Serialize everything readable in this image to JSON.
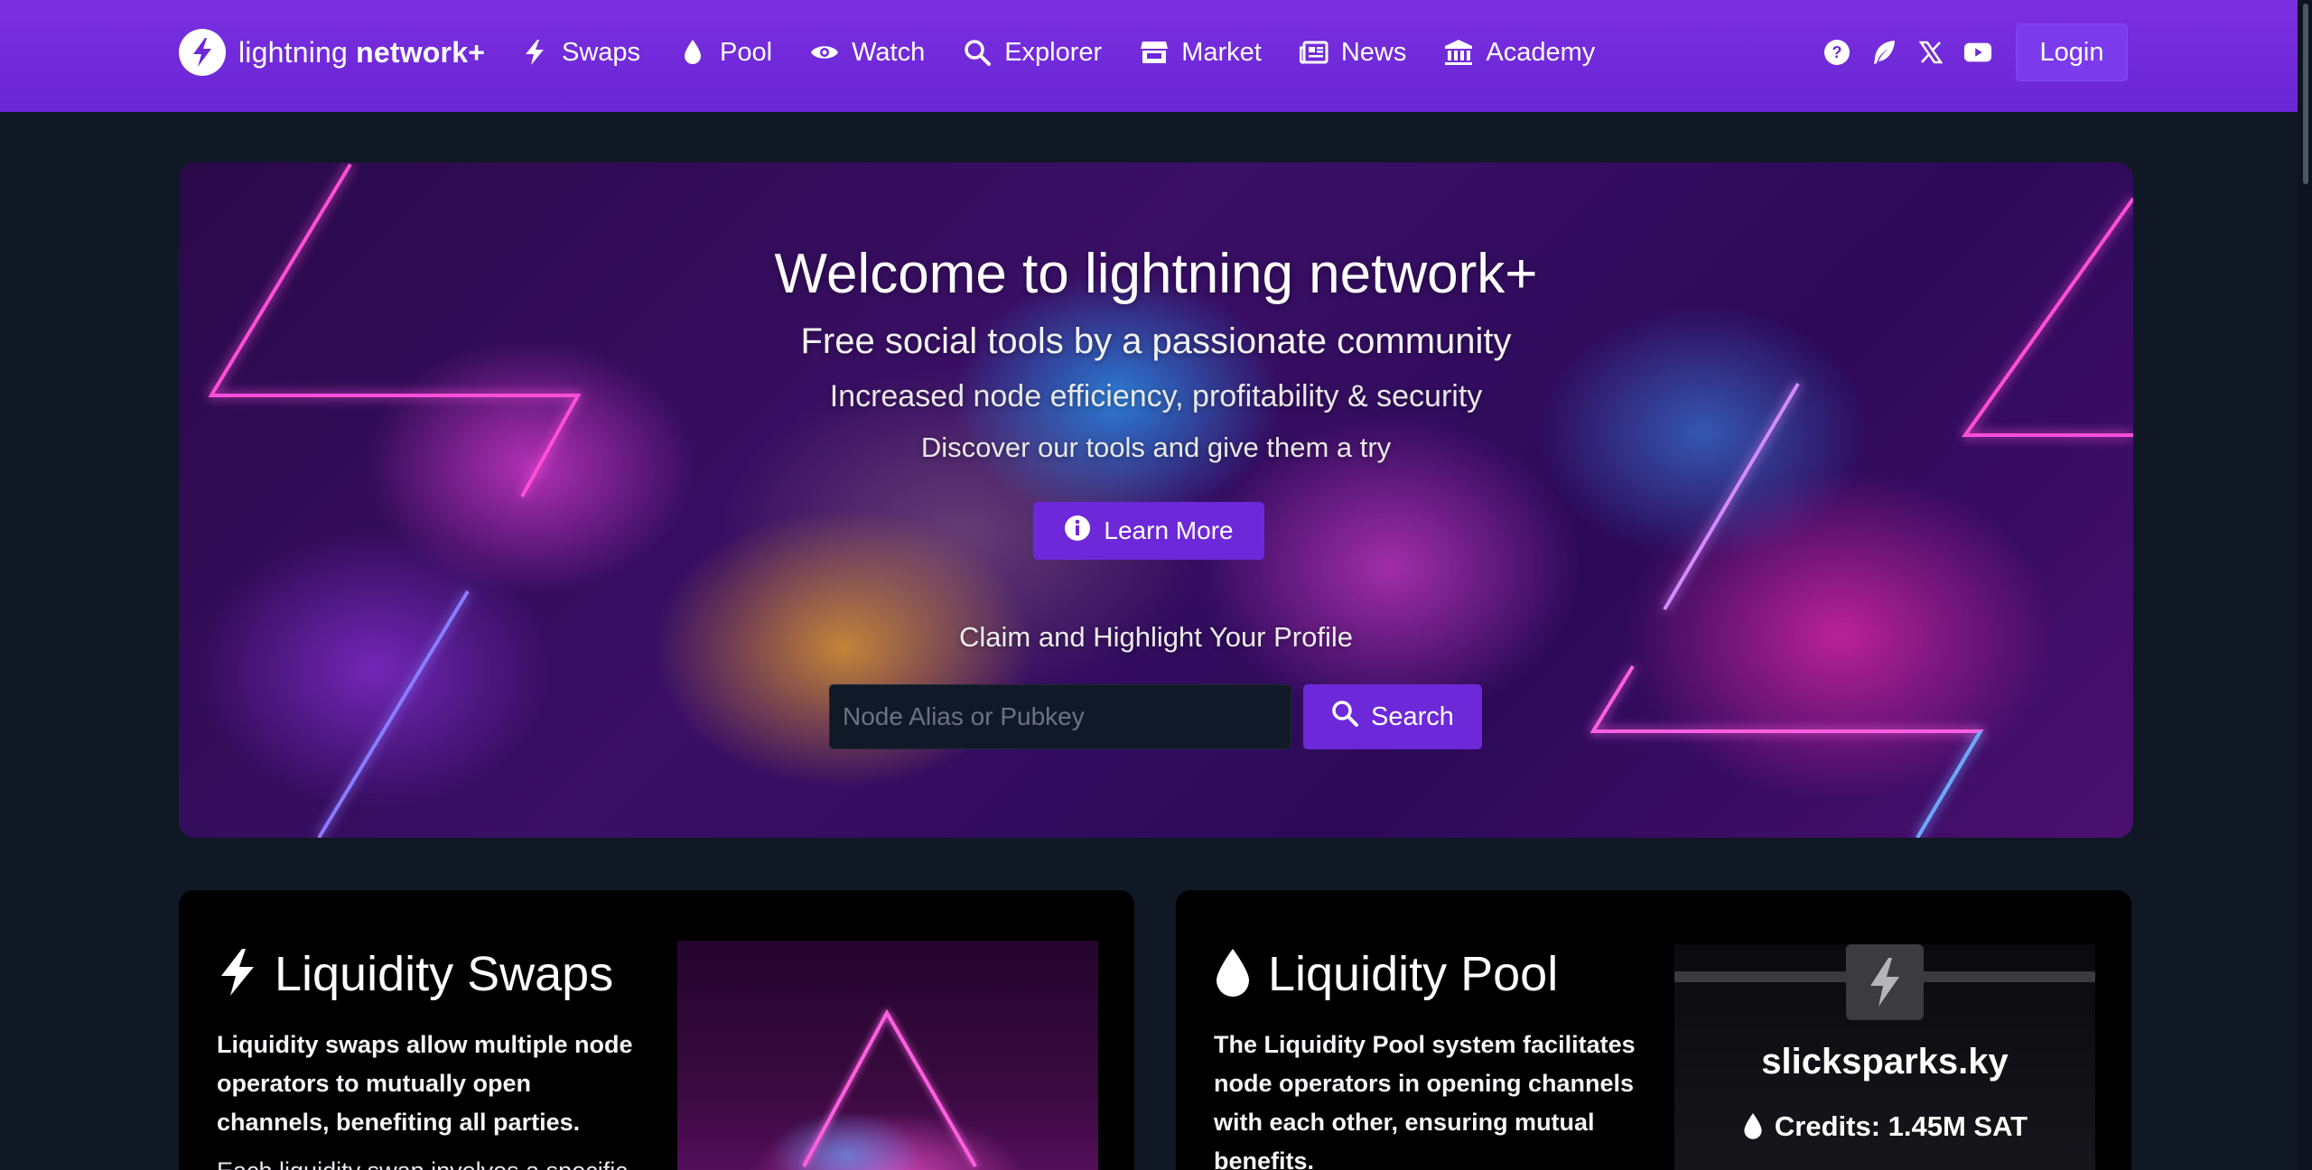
{
  "navbar": {
    "brand_light": "lightning",
    "brand_bold": "network+",
    "items": [
      {
        "label": "Swaps",
        "icon": "bolt-icon"
      },
      {
        "label": "Pool",
        "icon": "droplet-icon"
      },
      {
        "label": "Watch",
        "icon": "eye-icon"
      },
      {
        "label": "Explorer",
        "icon": "search-icon"
      },
      {
        "label": "Market",
        "icon": "store-icon"
      },
      {
        "label": "News",
        "icon": "newspaper-icon"
      },
      {
        "label": "Academy",
        "icon": "university-icon"
      }
    ],
    "right_icons": [
      "help-icon",
      "feather-icon",
      "x-twitter-icon",
      "youtube-icon"
    ],
    "login_label": "Login"
  },
  "hero": {
    "title": "Welcome to lightning network+",
    "subtitle1": "Free social tools by a passionate community",
    "subtitle2": "Increased node efficiency, profitability & security",
    "subtitle3": "Discover our tools and give them a try",
    "learn_more_label": "Learn More",
    "claim_label": "Claim and Highlight Your Profile",
    "search_placeholder": "Node Alias or Pubkey",
    "search_label": "Search"
  },
  "cards": {
    "swaps": {
      "title": "Liquidity Swaps",
      "description": "Liquidity swaps allow multiple node operators to mutually open channels, benefiting all parties.",
      "description2": "Each liquidity swap involves a specific"
    },
    "pool": {
      "title": "Liquidity Pool",
      "description": "The Liquidity Pool system facilitates node operators in opening channels with each other, ensuring mutual benefits.",
      "node_name": "slicksparks.ky",
      "credits": "Credits: 1.45M SAT"
    }
  },
  "colors": {
    "navbar": "#6d28d9",
    "accent": "#6d28d9",
    "background": "#101826",
    "card": "#000000"
  }
}
